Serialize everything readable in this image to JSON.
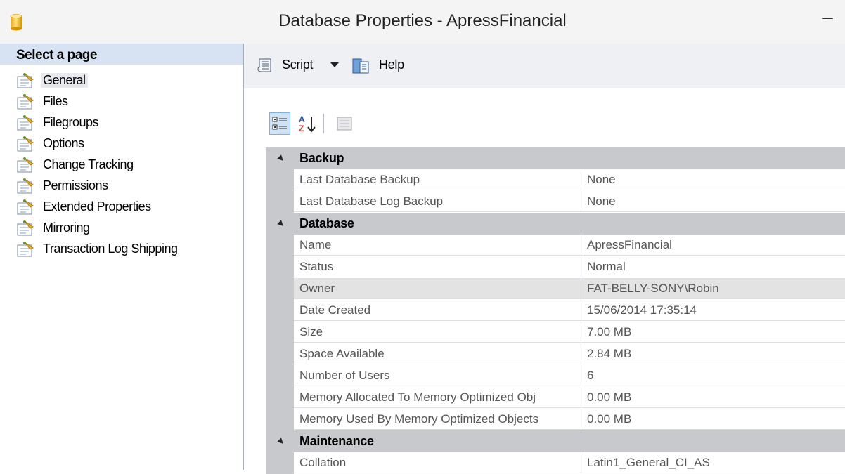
{
  "window": {
    "title": "Database Properties - ApressFinancial",
    "minimize": "–"
  },
  "left_panel": {
    "header": "Select a page",
    "pages": [
      {
        "label": "General",
        "selected": true
      },
      {
        "label": "Files"
      },
      {
        "label": "Filegroups"
      },
      {
        "label": "Options"
      },
      {
        "label": "Change Tracking"
      },
      {
        "label": "Permissions"
      },
      {
        "label": "Extended Properties"
      },
      {
        "label": "Mirroring"
      },
      {
        "label": "Transaction Log Shipping"
      }
    ]
  },
  "toolbar": {
    "script_label": "Script",
    "help_label": "Help"
  },
  "property_tools": {
    "sort_categorized_icon": "categorized-icon",
    "sort_alphabetical_icon": "sort-az-icon",
    "property_pages_icon": "property-pages-icon"
  },
  "properties": {
    "backup": {
      "label": "Backup",
      "rows": [
        {
          "name": "Last Database Backup",
          "value": "None"
        },
        {
          "name": "Last Database Log Backup",
          "value": "None"
        }
      ]
    },
    "database": {
      "label": "Database",
      "rows": [
        {
          "name": "Name",
          "value": "ApressFinancial"
        },
        {
          "name": "Status",
          "value": "Normal"
        },
        {
          "name": "Owner",
          "value": "FAT-BELLY-SONY\\Robin",
          "selected": true
        },
        {
          "name": "Date Created",
          "value": "15/06/2014 17:35:14"
        },
        {
          "name": "Size",
          "value": "7.00 MB"
        },
        {
          "name": "Space Available",
          "value": "2.84 MB"
        },
        {
          "name": "Number of Users",
          "value": "6"
        },
        {
          "name": "Memory Allocated To Memory Optimized Obj",
          "value": "0.00 MB"
        },
        {
          "name": "Memory Used By Memory Optimized Objects",
          "value": "0.00 MB"
        }
      ]
    },
    "maintenance": {
      "label": "Maintenance",
      "rows": [
        {
          "name": "Collation",
          "value": "Latin1_General_CI_AS"
        }
      ]
    }
  },
  "colors": {
    "selected_page_header": "#d7e3f2",
    "category_band": "#c8c9cc",
    "toolbar_bg": "#eff0f3"
  }
}
